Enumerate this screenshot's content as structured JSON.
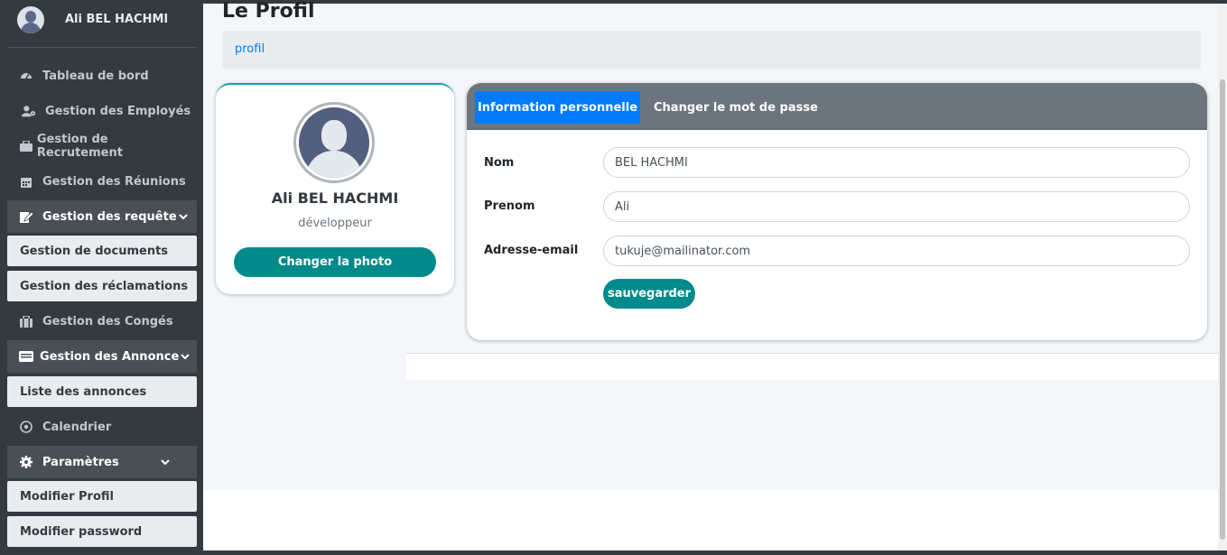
{
  "user": {
    "name": "Ali BEL HACHMI"
  },
  "sidebar": {
    "items": [
      {
        "label": "Tableau de bord",
        "icon": "gauge-icon"
      },
      {
        "label": "Gestion des Employés",
        "icon": "user-gear-icon"
      },
      {
        "label": "Gestion de Recrutement",
        "icon": "briefcase-icon"
      },
      {
        "label": "Gestion des Réunions",
        "icon": "calendar-icon"
      },
      {
        "label": "Gestion des requête",
        "icon": "edit-icon"
      },
      {
        "label": "Gestion de documents"
      },
      {
        "label": "Gestion des réclamations"
      },
      {
        "label": "Gestion des Congés",
        "icon": "suitcase-icon"
      },
      {
        "label": "Gestion des Annonce",
        "icon": "card-icon"
      },
      {
        "label": "Liste des annonces"
      },
      {
        "label": "Calendrier",
        "icon": "circle-dot-icon"
      },
      {
        "label": "Paramètres",
        "icon": "gear-icon"
      },
      {
        "label": "Modifier Profil"
      },
      {
        "label": "Modifier password"
      }
    ]
  },
  "page": {
    "title": "Le Profil",
    "breadcrumb": "profil"
  },
  "profile_card": {
    "name": "Ali BEL HACHMI",
    "role": "développeur",
    "change_photo": "Changer la photo"
  },
  "form": {
    "tabs": [
      "Information personnelle",
      "Changer le mot de passe"
    ],
    "fields": [
      {
        "label": "Nom",
        "value": "BEL HACHMI"
      },
      {
        "label": "Prenom",
        "value": "Ali"
      },
      {
        "label": "Adresse-email",
        "value": "tukuje@mailinator.com"
      }
    ],
    "save": "sauvegarder"
  },
  "colors": {
    "sidebar_bg": "#343a40",
    "primary": "#007bff",
    "teal_button": "#008b8b",
    "tab_header": "#6c757d",
    "breadcrumb_link": "#007bff"
  }
}
